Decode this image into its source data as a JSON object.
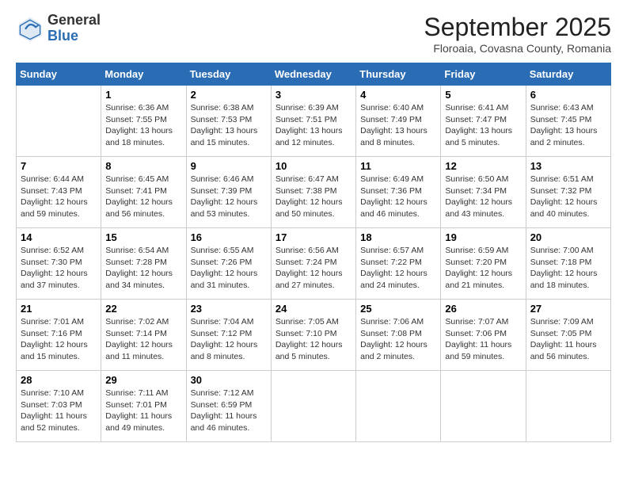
{
  "logo": {
    "general": "General",
    "blue": "Blue"
  },
  "header": {
    "month_year": "September 2025",
    "location": "Floroaia, Covasna County, Romania"
  },
  "days_of_week": [
    "Sunday",
    "Monday",
    "Tuesday",
    "Wednesday",
    "Thursday",
    "Friday",
    "Saturday"
  ],
  "weeks": [
    [
      {
        "day": "",
        "info": ""
      },
      {
        "day": "1",
        "info": "Sunrise: 6:36 AM\nSunset: 7:55 PM\nDaylight: 13 hours and 18 minutes."
      },
      {
        "day": "2",
        "info": "Sunrise: 6:38 AM\nSunset: 7:53 PM\nDaylight: 13 hours and 15 minutes."
      },
      {
        "day": "3",
        "info": "Sunrise: 6:39 AM\nSunset: 7:51 PM\nDaylight: 13 hours and 12 minutes."
      },
      {
        "day": "4",
        "info": "Sunrise: 6:40 AM\nSunset: 7:49 PM\nDaylight: 13 hours and 8 minutes."
      },
      {
        "day": "5",
        "info": "Sunrise: 6:41 AM\nSunset: 7:47 PM\nDaylight: 13 hours and 5 minutes."
      },
      {
        "day": "6",
        "info": "Sunrise: 6:43 AM\nSunset: 7:45 PM\nDaylight: 13 hours and 2 minutes."
      }
    ],
    [
      {
        "day": "7",
        "info": "Sunrise: 6:44 AM\nSunset: 7:43 PM\nDaylight: 12 hours and 59 minutes."
      },
      {
        "day": "8",
        "info": "Sunrise: 6:45 AM\nSunset: 7:41 PM\nDaylight: 12 hours and 56 minutes."
      },
      {
        "day": "9",
        "info": "Sunrise: 6:46 AM\nSunset: 7:39 PM\nDaylight: 12 hours and 53 minutes."
      },
      {
        "day": "10",
        "info": "Sunrise: 6:47 AM\nSunset: 7:38 PM\nDaylight: 12 hours and 50 minutes."
      },
      {
        "day": "11",
        "info": "Sunrise: 6:49 AM\nSunset: 7:36 PM\nDaylight: 12 hours and 46 minutes."
      },
      {
        "day": "12",
        "info": "Sunrise: 6:50 AM\nSunset: 7:34 PM\nDaylight: 12 hours and 43 minutes."
      },
      {
        "day": "13",
        "info": "Sunrise: 6:51 AM\nSunset: 7:32 PM\nDaylight: 12 hours and 40 minutes."
      }
    ],
    [
      {
        "day": "14",
        "info": "Sunrise: 6:52 AM\nSunset: 7:30 PM\nDaylight: 12 hours and 37 minutes."
      },
      {
        "day": "15",
        "info": "Sunrise: 6:54 AM\nSunset: 7:28 PM\nDaylight: 12 hours and 34 minutes."
      },
      {
        "day": "16",
        "info": "Sunrise: 6:55 AM\nSunset: 7:26 PM\nDaylight: 12 hours and 31 minutes."
      },
      {
        "day": "17",
        "info": "Sunrise: 6:56 AM\nSunset: 7:24 PM\nDaylight: 12 hours and 27 minutes."
      },
      {
        "day": "18",
        "info": "Sunrise: 6:57 AM\nSunset: 7:22 PM\nDaylight: 12 hours and 24 minutes."
      },
      {
        "day": "19",
        "info": "Sunrise: 6:59 AM\nSunset: 7:20 PM\nDaylight: 12 hours and 21 minutes."
      },
      {
        "day": "20",
        "info": "Sunrise: 7:00 AM\nSunset: 7:18 PM\nDaylight: 12 hours and 18 minutes."
      }
    ],
    [
      {
        "day": "21",
        "info": "Sunrise: 7:01 AM\nSunset: 7:16 PM\nDaylight: 12 hours and 15 minutes."
      },
      {
        "day": "22",
        "info": "Sunrise: 7:02 AM\nSunset: 7:14 PM\nDaylight: 12 hours and 11 minutes."
      },
      {
        "day": "23",
        "info": "Sunrise: 7:04 AM\nSunset: 7:12 PM\nDaylight: 12 hours and 8 minutes."
      },
      {
        "day": "24",
        "info": "Sunrise: 7:05 AM\nSunset: 7:10 PM\nDaylight: 12 hours and 5 minutes."
      },
      {
        "day": "25",
        "info": "Sunrise: 7:06 AM\nSunset: 7:08 PM\nDaylight: 12 hours and 2 minutes."
      },
      {
        "day": "26",
        "info": "Sunrise: 7:07 AM\nSunset: 7:06 PM\nDaylight: 11 hours and 59 minutes."
      },
      {
        "day": "27",
        "info": "Sunrise: 7:09 AM\nSunset: 7:05 PM\nDaylight: 11 hours and 56 minutes."
      }
    ],
    [
      {
        "day": "28",
        "info": "Sunrise: 7:10 AM\nSunset: 7:03 PM\nDaylight: 11 hours and 52 minutes."
      },
      {
        "day": "29",
        "info": "Sunrise: 7:11 AM\nSunset: 7:01 PM\nDaylight: 11 hours and 49 minutes."
      },
      {
        "day": "30",
        "info": "Sunrise: 7:12 AM\nSunset: 6:59 PM\nDaylight: 11 hours and 46 minutes."
      },
      {
        "day": "",
        "info": ""
      },
      {
        "day": "",
        "info": ""
      },
      {
        "day": "",
        "info": ""
      },
      {
        "day": "",
        "info": ""
      }
    ]
  ]
}
